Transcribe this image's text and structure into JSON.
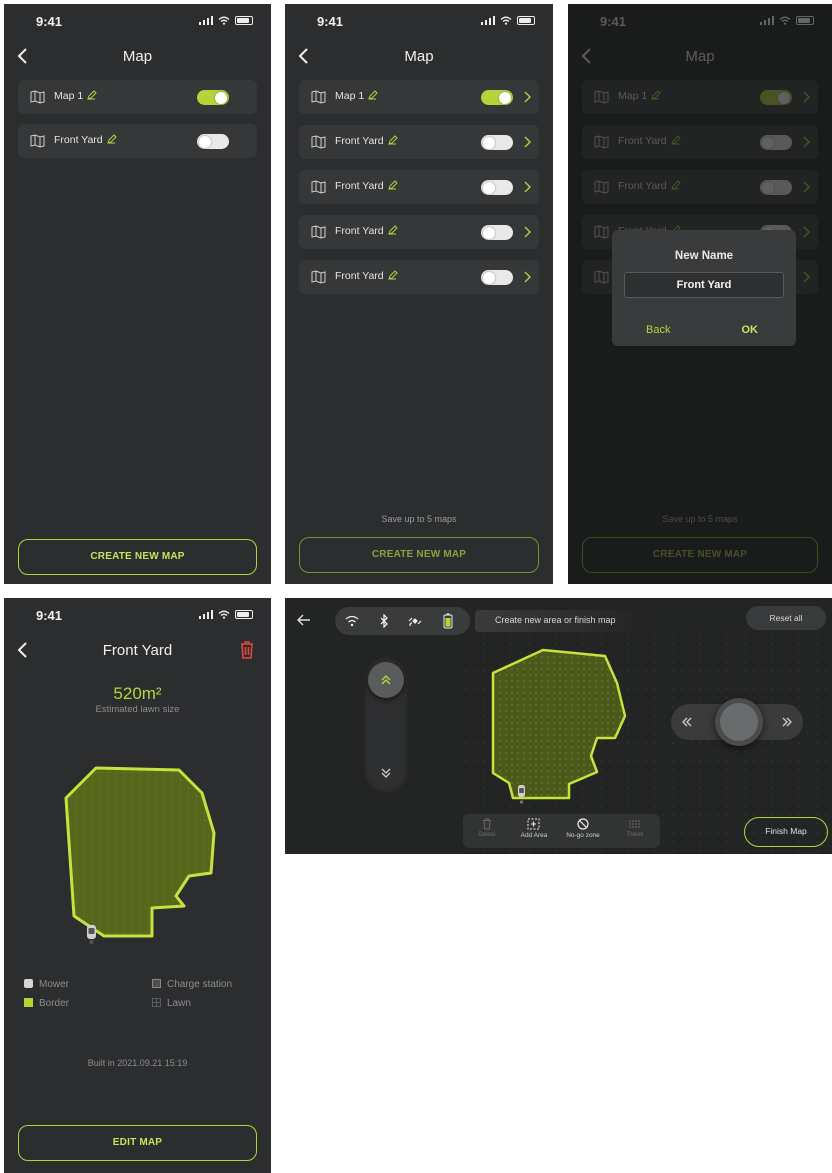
{
  "status": {
    "time": "9:41"
  },
  "colors": {
    "accent": "#b5d43b",
    "background": "#2c2d2e",
    "row": "#363738",
    "danger": "#e2463a"
  },
  "screen1": {
    "title": "Map",
    "rows": [
      {
        "name": "Map 1",
        "toggle_on": true
      },
      {
        "name": "Front Yard",
        "toggle_on": false
      }
    ],
    "create_button": "CREATE NEW MAP"
  },
  "screen2": {
    "title": "Map",
    "rows": [
      {
        "name": "Map 1",
        "toggle_on": true
      },
      {
        "name": "Front Yard",
        "toggle_on": false
      },
      {
        "name": "Front Yard",
        "toggle_on": false
      },
      {
        "name": "Front Yard",
        "toggle_on": false
      },
      {
        "name": "Front Yard",
        "toggle_on": false
      }
    ],
    "note": "Save up to 5 maps",
    "create_button": "CREATE NEW MAP"
  },
  "screen3": {
    "title": "Map",
    "rows": [
      {
        "name": "Map 1",
        "toggle_on": true
      },
      {
        "name": "Front Yard",
        "toggle_on": false
      },
      {
        "name": "Front Yard",
        "toggle_on": false
      },
      {
        "name": "Front Yard",
        "toggle_on": false
      },
      {
        "name": "Front Yard",
        "toggle_on": false
      }
    ],
    "note": "Save up to 5 maps",
    "create_button": "CREATE NEW MAP",
    "dialog": {
      "title": "New Name",
      "value": "Front Yard",
      "back": "Back",
      "ok": "OK"
    }
  },
  "screen4": {
    "title": "Front Yard",
    "area": "520m²",
    "area_caption": "Estimated lawn size",
    "legend": {
      "mower": "Mower",
      "charge": "Charge station",
      "border": "Border",
      "lawn": "Lawn"
    },
    "built": "Built in 2021.09.21 15:19",
    "edit_button": "EDIT MAP"
  },
  "screen5": {
    "hint": "Create new area or finish map",
    "reset": "Reset all",
    "tools": [
      "Delete",
      "Add Area",
      "No-go zone",
      "Travel"
    ],
    "finish": "Finish Map",
    "status_icons": [
      "wifi-icon",
      "bluetooth-icon",
      "satellite-icon",
      "battery-icon"
    ]
  }
}
